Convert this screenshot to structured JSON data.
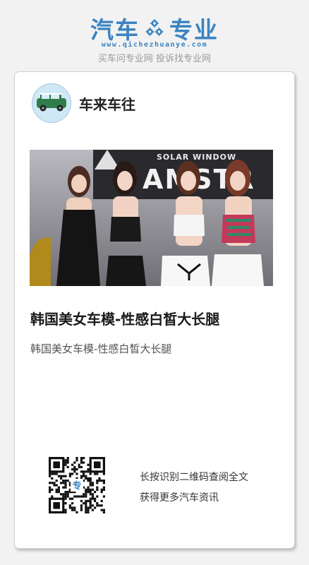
{
  "header": {
    "logo_left": "汽车",
    "logo_right": "专业",
    "logo_url": "www.qichezhuanye.com",
    "slogan": "买车问专业网 投诉找专业网",
    "brand_color": "#3b83c1"
  },
  "article": {
    "author": "车来车往",
    "image_text": "SOLAR WINDOW",
    "image_brand": "AMSTR",
    "title": "韩国美女车模-性感白皙大长腿",
    "summary": "韩国美女车模-性感白皙大长腿"
  },
  "share": {
    "line1": "长按识别二维码查阅全文",
    "line2": "获得更多汽车资讯",
    "qr_badge": "专"
  }
}
